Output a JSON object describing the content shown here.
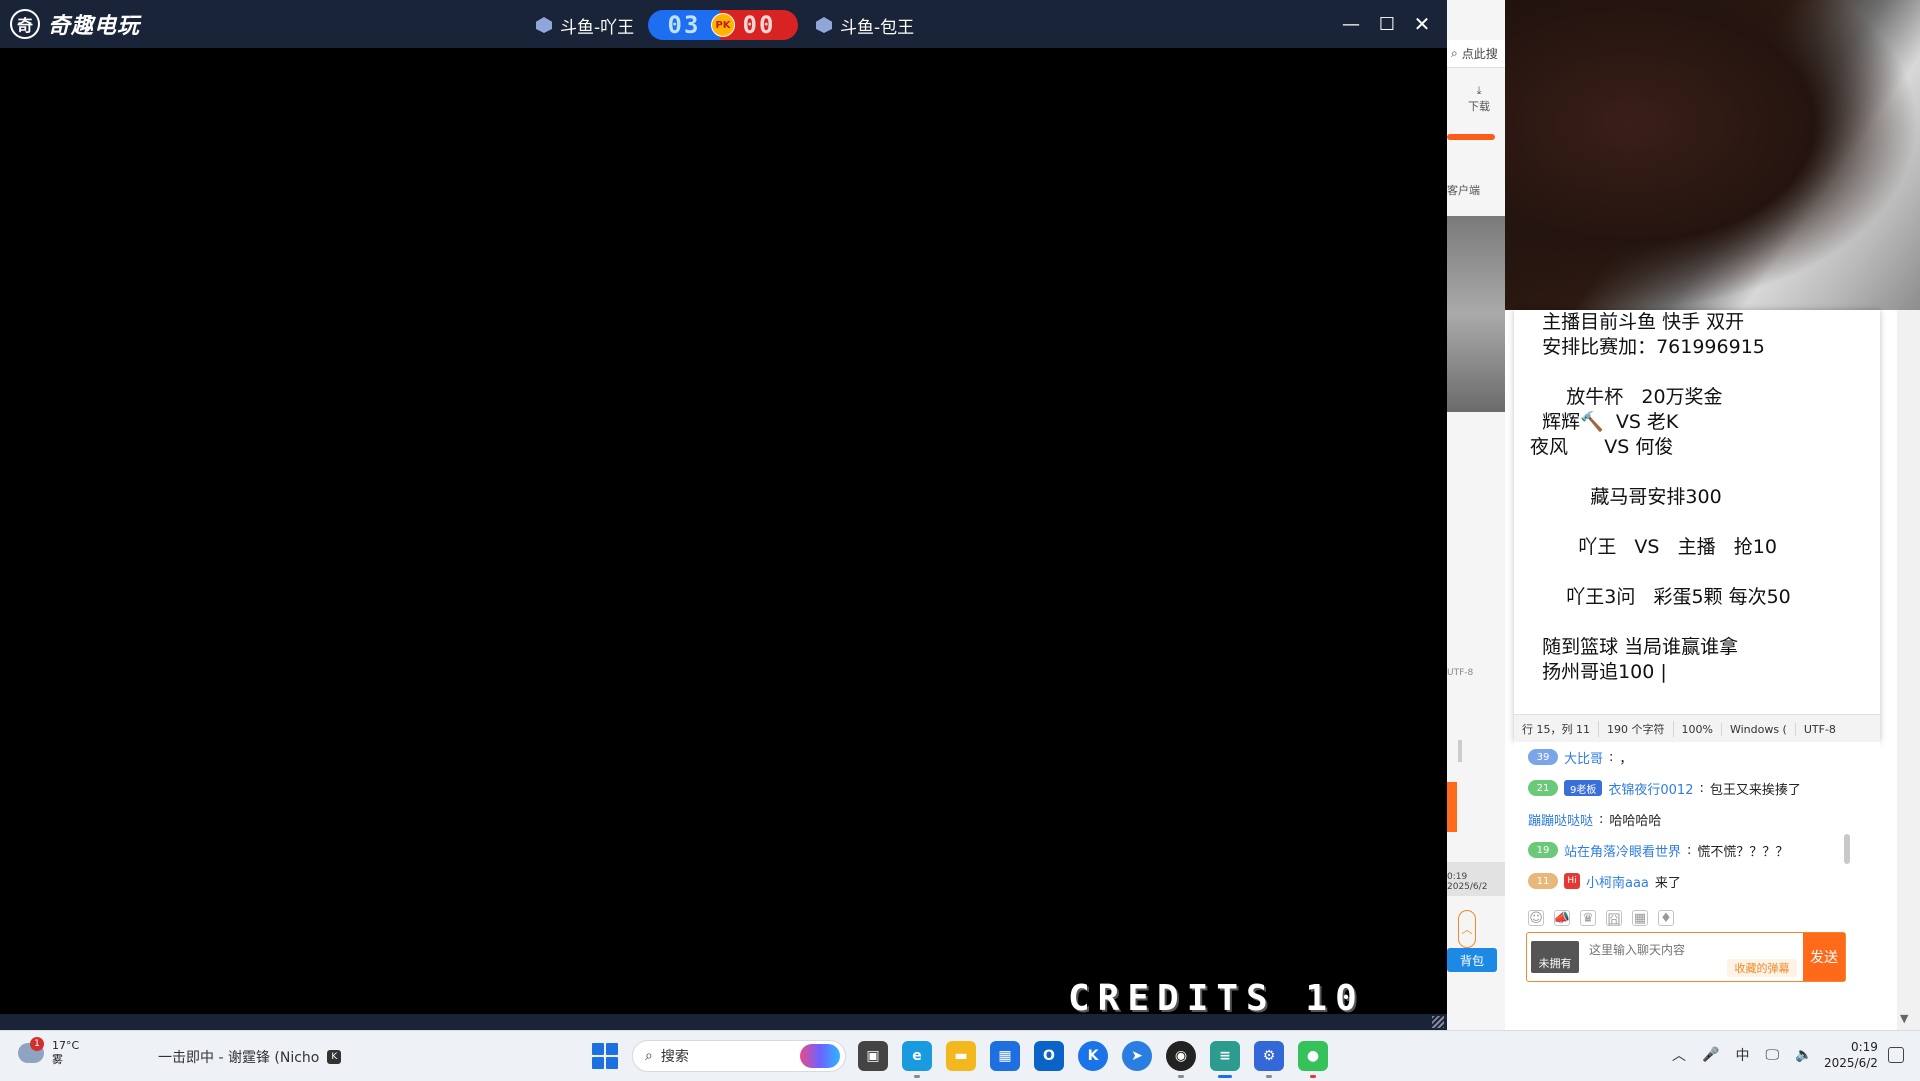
{
  "game": {
    "app_name": "奇趣电玩",
    "logo_glyph": "奇",
    "player_left": "斗鱼-吖王",
    "player_right": "斗鱼-包王",
    "score_left": "03",
    "score_right": "00",
    "pk_label": "PK",
    "credits": "CREDITS 10",
    "controls": {
      "minimize": "—",
      "maximize": "☐",
      "close": "✕"
    }
  },
  "background_browser": {
    "search_text": "点此搜",
    "download_label": "下载",
    "client_label": "客户端",
    "encoding": "UTF-8",
    "time": "0:19",
    "date": "2025/6/2",
    "gift_label": "背包"
  },
  "notepad": {
    "content": "  主播目前斗鱼 快手 双开\n  安排比赛加：761996915\n\n      放牛杯   20万奖金\n  辉辉🔨  VS 老K\n夜风      VS 何俊\n\n          藏马哥安排300\n\n        吖王   VS   主播   抢10\n\n      吖王3问   彩蛋5颗 每次50\n\n  随到篮球 当局谁赢谁拿\n  扬州哥追100 |",
    "status": {
      "position": "行 15，列 11",
      "chars": "190 个字符",
      "zoom": "100%",
      "line_ending": "Windows (",
      "encoding": "UTF-8"
    }
  },
  "chat": {
    "messages": [
      {
        "level": "39",
        "level_color": "#7aa6e8",
        "user": "大比哥",
        "sep": ":",
        "text": "，"
      },
      {
        "level": "21",
        "level_color": "#6cc97a",
        "fan_badge": "9老板",
        "user": "衣锦夜行0012",
        "sep": ":",
        "text": "包王又来挨揍了"
      },
      {
        "user": "蹦蹦哒哒哒",
        "sep": ":",
        "text": "哈哈哈哈"
      },
      {
        "level": "19",
        "level_color": "#6cc97a",
        "user": "站在角落冷眼看世界",
        "sep": ":",
        "text": "慌不慌？？？？"
      },
      {
        "level": "11",
        "level_color": "#e8b87a",
        "hi_badge": "Hi",
        "user": "小柯南aaa",
        "text": "来了"
      }
    ],
    "toolbar_icons": [
      "emoji-icon",
      "megaphone-icon",
      "crown-icon",
      "gift-icon",
      "image-icon",
      "card-icon"
    ],
    "toolbar_glyphs": [
      "☺",
      "📣",
      "♛",
      "囧",
      "▦",
      "♦"
    ],
    "no_have_label": "未拥有",
    "input_placeholder": "这里输入聊天内容",
    "fav_barrage": "收藏的弹幕",
    "send_label": "发送"
  },
  "taskbar": {
    "weather_temp": "17°C",
    "weather_desc": "雾",
    "weather_badge": "1",
    "media_title": "一击即中 - 谢霆锋 (Nicho",
    "media_glyph": "K",
    "search_placeholder": "搜索",
    "apps": [
      {
        "name": "task-view-app",
        "glyph": "▣",
        "color": "#444444"
      },
      {
        "name": "edge-app",
        "glyph": "e",
        "color": "#1a9be0"
      },
      {
        "name": "file-explorer-app",
        "glyph": "▬",
        "color": "#f2b81e"
      },
      {
        "name": "store-app",
        "glyph": "▦",
        "color": "#1e6fe0"
      },
      {
        "name": "outlook-app",
        "glyph": "O",
        "color": "#0a64c8"
      },
      {
        "name": "kugou-app",
        "glyph": "K",
        "color": "#1a73e8"
      },
      {
        "name": "arrow-app",
        "glyph": "➤",
        "color": "#2a7de1"
      },
      {
        "name": "obs-app",
        "glyph": "◉",
        "color": "#222222"
      },
      {
        "name": "notepad-app",
        "glyph": "≡",
        "color": "#2e9b8f"
      },
      {
        "name": "settings-app",
        "glyph": "⚙",
        "color": "#3468d8"
      },
      {
        "name": "wechat-app",
        "glyph": "●",
        "color": "#36c25b"
      }
    ],
    "tray": {
      "chevron": "︿",
      "mic": "🎤",
      "ime": "中",
      "network": "🖵",
      "volume": "🔈"
    },
    "time": "0:19",
    "date": "2025/6/2"
  }
}
